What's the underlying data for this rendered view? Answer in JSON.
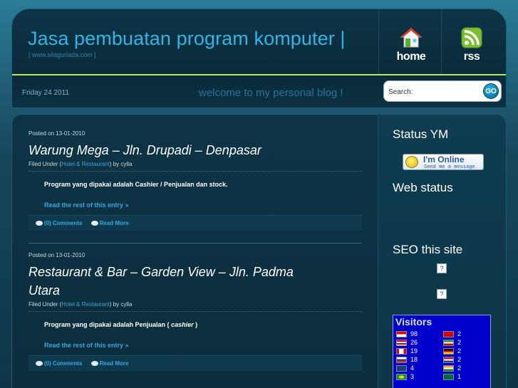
{
  "header": {
    "title": "Jasa pembuatan program komputer |",
    "subtitle": "[ www.silaguriada.com ]",
    "nav": [
      {
        "label": "home",
        "icon": "home-icon"
      },
      {
        "label": "rss",
        "icon": "rss-icon"
      }
    ],
    "date": "Friday 24 2011",
    "welcome": "welcome to my personal blog !",
    "search": {
      "placeholder": "Search:",
      "button": "GO"
    }
  },
  "posts": [
    {
      "date": "Posted on 13-01-2010",
      "title": "Warung Mega – Jln. Drupadi – Denpasar",
      "filed_prefix": "Filed Under (",
      "category": "Hotel & Restaurant",
      "filed_suffix": ") by cylla",
      "excerpt": "Program yang dipakai adalah Cashier / Penjualan dan stock.",
      "read_more": "Read the rest of this entry »",
      "comments": "(0) Comments",
      "more": "Read More"
    },
    {
      "date": "Posted on 13-01-2010",
      "title": "Restaurant & Bar – Garden View – Jln. Padma Utara",
      "filed_prefix": "Filed Under (",
      "category": "Hotel & Restaurant",
      "filed_suffix": ") by cylla",
      "excerpt_prefix": "Program yang dipakai adalah Penjualan ( ",
      "excerpt_italic": "cashier",
      "excerpt_suffix": " )",
      "read_more": "Read the rest of this entry »",
      "comments": "(0) Comments",
      "more": "Read More"
    }
  ],
  "sidebar": {
    "status_ym": "Status YM",
    "ym_badge": {
      "line1": "I'm Online",
      "line2": "Send me a message"
    },
    "web_status": "Web status",
    "seo": "SEO this site",
    "qmark": "?",
    "visitors": {
      "title": "Visitors",
      "rows": [
        {
          "left": "98",
          "right": "2"
        },
        {
          "left": "26",
          "right": "2"
        },
        {
          "left": "19",
          "right": "2"
        },
        {
          "left": "18",
          "right": "2"
        },
        {
          "left": "4",
          "right": "2"
        },
        {
          "left": "3",
          "right": "1"
        }
      ]
    }
  },
  "colors": {
    "accent": "#2fb6e6",
    "link": "#34a9e0",
    "header_line": "#b8e86a"
  }
}
